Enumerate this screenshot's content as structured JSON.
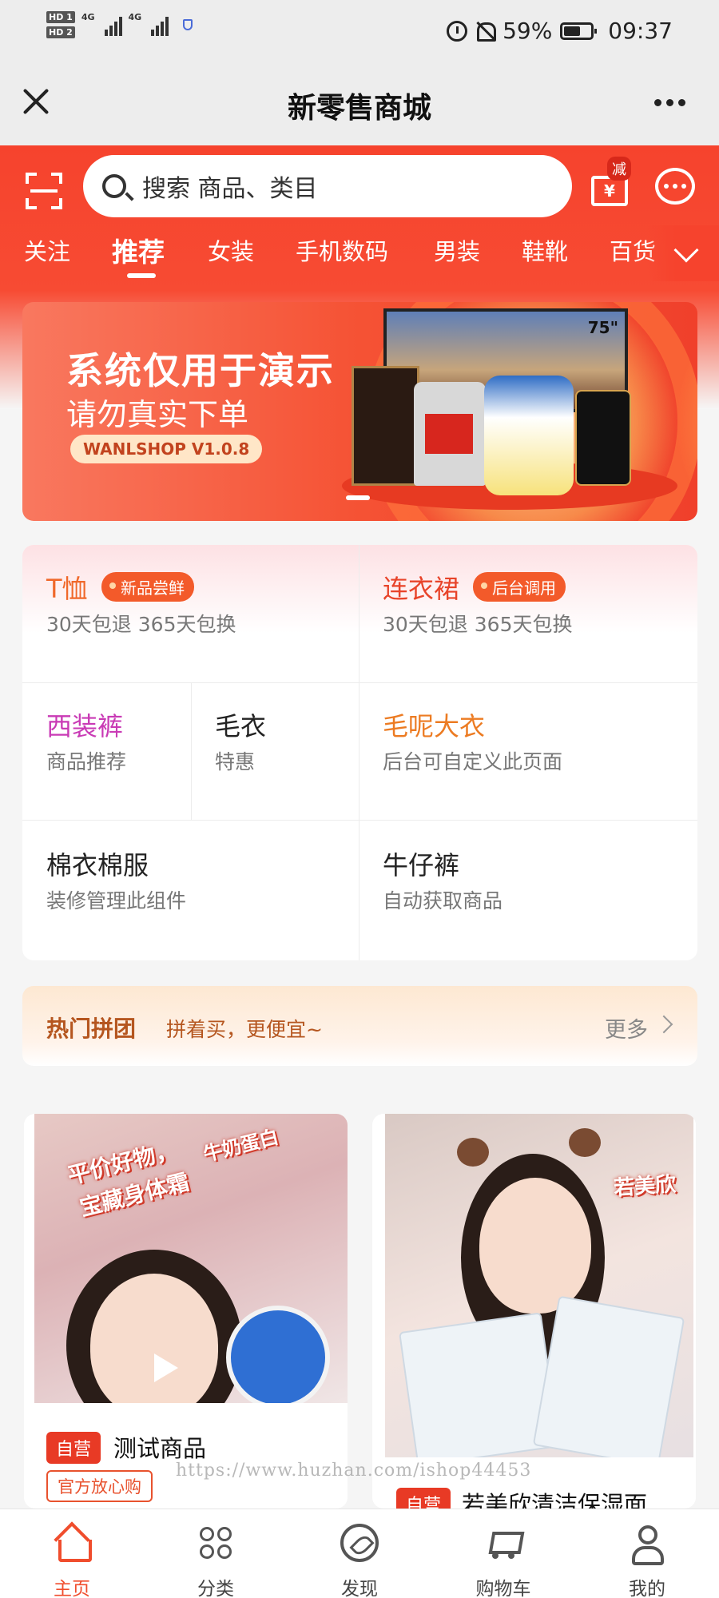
{
  "status_bar": {
    "sim1": "HD 1",
    "sim2": "HD 2",
    "net1": "4G",
    "net2": "4G",
    "battery": "59%",
    "time": "09:37"
  },
  "title_bar": {
    "title": "新零售商城"
  },
  "header": {
    "search_placeholder": "搜索 商品、类目",
    "coupon_badge": "减",
    "coupon_symbol": "¥"
  },
  "tabs": [
    {
      "label": "关注",
      "active": false
    },
    {
      "label": "推荐",
      "active": true
    },
    {
      "label": "女装",
      "active": false
    },
    {
      "label": "手机数码",
      "active": false
    },
    {
      "label": "男装",
      "active": false
    },
    {
      "label": "鞋靴",
      "active": false
    },
    {
      "label": "百货",
      "active": false
    }
  ],
  "banner": {
    "headline": "系统仅用于演示",
    "subline": "请勿真实下单",
    "tag": "WANLSHOP V1.0.8",
    "tv_size": "75\""
  },
  "categories": {
    "tshirt": {
      "title": "T恤",
      "badge": "新品尝鲜",
      "sub": "30天包退 365天包换"
    },
    "dress": {
      "title": "连衣裙",
      "badge": "后台调用",
      "sub": "30天包退 365天包换"
    },
    "trousers": {
      "title": "西装裤",
      "sub": "商品推荐"
    },
    "sweater": {
      "title": "毛衣",
      "sub": "特惠"
    },
    "coat": {
      "title": "毛呢大衣",
      "sub": "后台可自定义此页面"
    },
    "padded": {
      "title": "棉衣棉服",
      "sub": "装修管理此组件"
    },
    "jeans": {
      "title": "牛仔裤",
      "sub": "自动获取商品"
    }
  },
  "group_buy": {
    "title": "热门拼团",
    "subtitle": "拼着买，更便宜~",
    "more": "更多"
  },
  "products": [
    {
      "self_tag": "自营",
      "name": "测试商品",
      "official_tag": "官方放心购",
      "promo_1": "平价好物，",
      "promo_2": "宝藏身体霜",
      "promo_3": "牛奶蛋白"
    },
    {
      "self_tag": "自营",
      "name": "若美欣清洁保湿面",
      "brand_overlay": "若美欣"
    }
  ],
  "watermark": "https://www.huzhan.com/ishop44453",
  "bottom_nav": [
    {
      "label": "主页",
      "icon": "home-icon",
      "active": true
    },
    {
      "label": "分类",
      "icon": "grid-icon",
      "active": false
    },
    {
      "label": "发现",
      "icon": "compass-icon",
      "active": false
    },
    {
      "label": "购物车",
      "icon": "cart-icon",
      "active": false
    },
    {
      "label": "我的",
      "icon": "user-icon",
      "active": false
    }
  ],
  "colors": {
    "brand_red": "#f6432d",
    "accent_orange": "#f35a2a",
    "active_nav": "#f04d2d"
  }
}
